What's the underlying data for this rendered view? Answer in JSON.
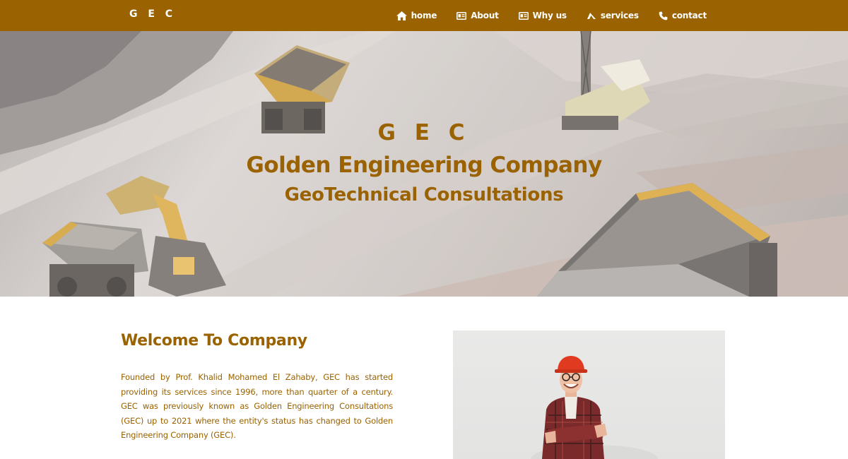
{
  "navbar": {
    "brand": "G E C",
    "links": [
      {
        "label": "home",
        "icon": "home-icon"
      },
      {
        "label": "About",
        "icon": "id-card-icon"
      },
      {
        "label": "Why us",
        "icon": "id-card-icon"
      },
      {
        "label": "services",
        "icon": "services-icon"
      },
      {
        "label": "contact",
        "icon": "phone-icon"
      }
    ]
  },
  "hero": {
    "abbr": "G E C",
    "title": "Golden Engineering Company",
    "subtitle": "GeoTechnical Consultations",
    "image": "open-pit mine with haul trucks, excavator and drill rig"
  },
  "welcome": {
    "heading": "Welcome To Company",
    "body": "Founded by Prof. Khalid Mohamed El Zahaby, GEC has started providing its services since 1996, more than quarter of a century. GEC was previously known as Golden Engineering Consultations (GEC) up to 2021 where the entity's status has changed to Golden Engineering Company (GEC)."
  },
  "photo": {
    "image": "smiling engineer in red hard hat and plaid shirt with arms crossed"
  },
  "colors": {
    "brand": "#9a6200",
    "nav_text": "#ffffff",
    "background": "#ffffff"
  }
}
